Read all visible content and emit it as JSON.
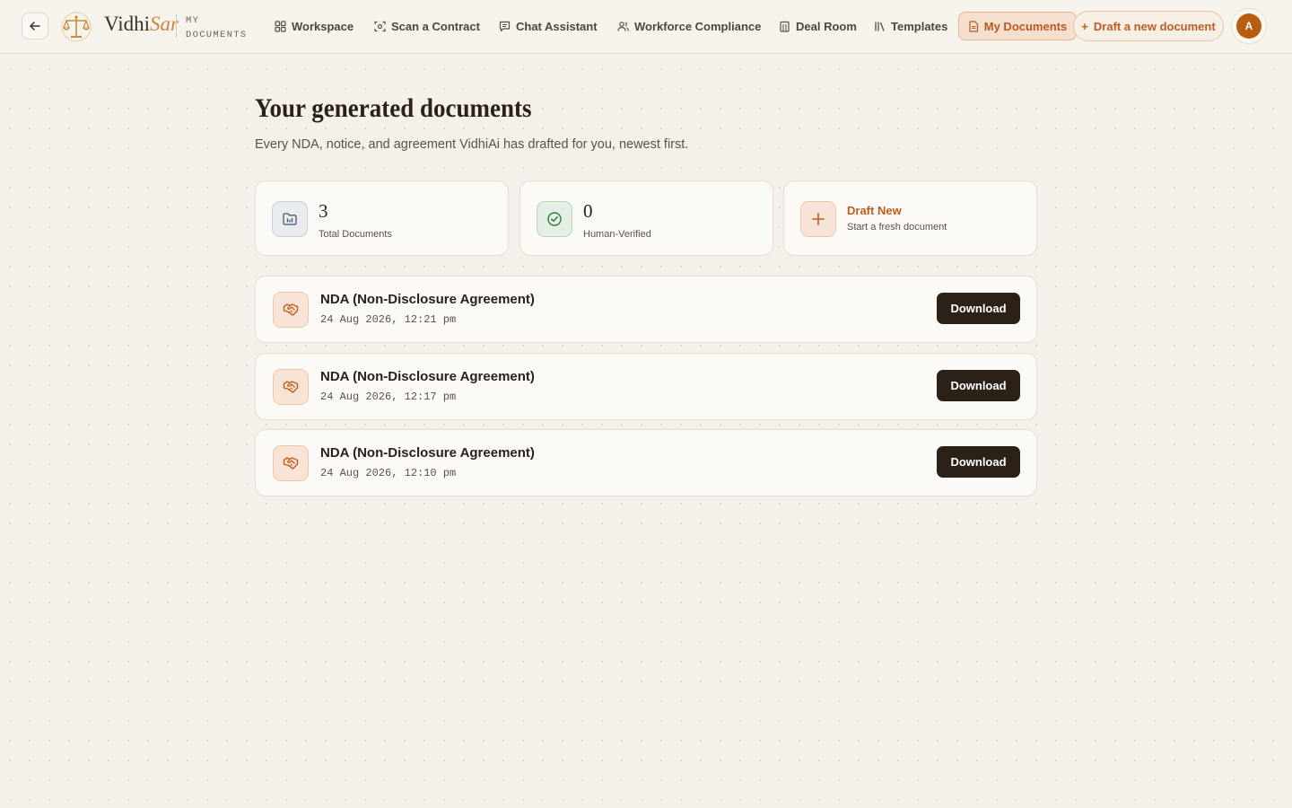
{
  "header": {
    "brand_first": "Vidhi",
    "brand_accent": "Sar",
    "section_tag": "MY DOCUMENTS",
    "nav": {
      "workspace": "Workspace",
      "scan": "Scan a Contract",
      "chat": "Chat Assistant",
      "workforce": "Workforce Compliance",
      "deal_room": "Deal Room",
      "templates": "Templates",
      "my_documents": "My Documents"
    },
    "draft_button": "Draft a new document",
    "draft_button_icon": "+",
    "avatar_initial": "A"
  },
  "main": {
    "title": "Your generated documents",
    "subtitle": "Every NDA, notice, and agreement VidhiAi has drafted for you, newest first."
  },
  "stats": {
    "total": {
      "value": "3",
      "label": "Total Documents",
      "icon": "folder-chart-icon"
    },
    "verified": {
      "value": "0",
      "label": "Human-Verified",
      "icon": "check-circle-icon"
    },
    "draft": {
      "title": "Draft New",
      "subtitle": "Start a fresh document",
      "icon": "plus-icon"
    }
  },
  "documents": [
    {
      "title": "NDA (Non-Disclosure Agreement)",
      "date": "24 Aug 2026, 12:21 pm",
      "action": "Download",
      "icon": "handshake-icon"
    },
    {
      "title": "NDA (Non-Disclosure Agreement)",
      "date": "24 Aug 2026, 12:17 pm",
      "action": "Download",
      "icon": "handshake-icon"
    },
    {
      "title": "NDA (Non-Disclosure Agreement)",
      "date": "24 Aug 2026, 12:10 pm",
      "action": "Download",
      "icon": "handshake-icon"
    }
  ],
  "colors": {
    "accent": "#c05c1f",
    "brand_gold": "#c9893b",
    "dark_button": "#2b2116",
    "background": "#f5f1ea"
  }
}
